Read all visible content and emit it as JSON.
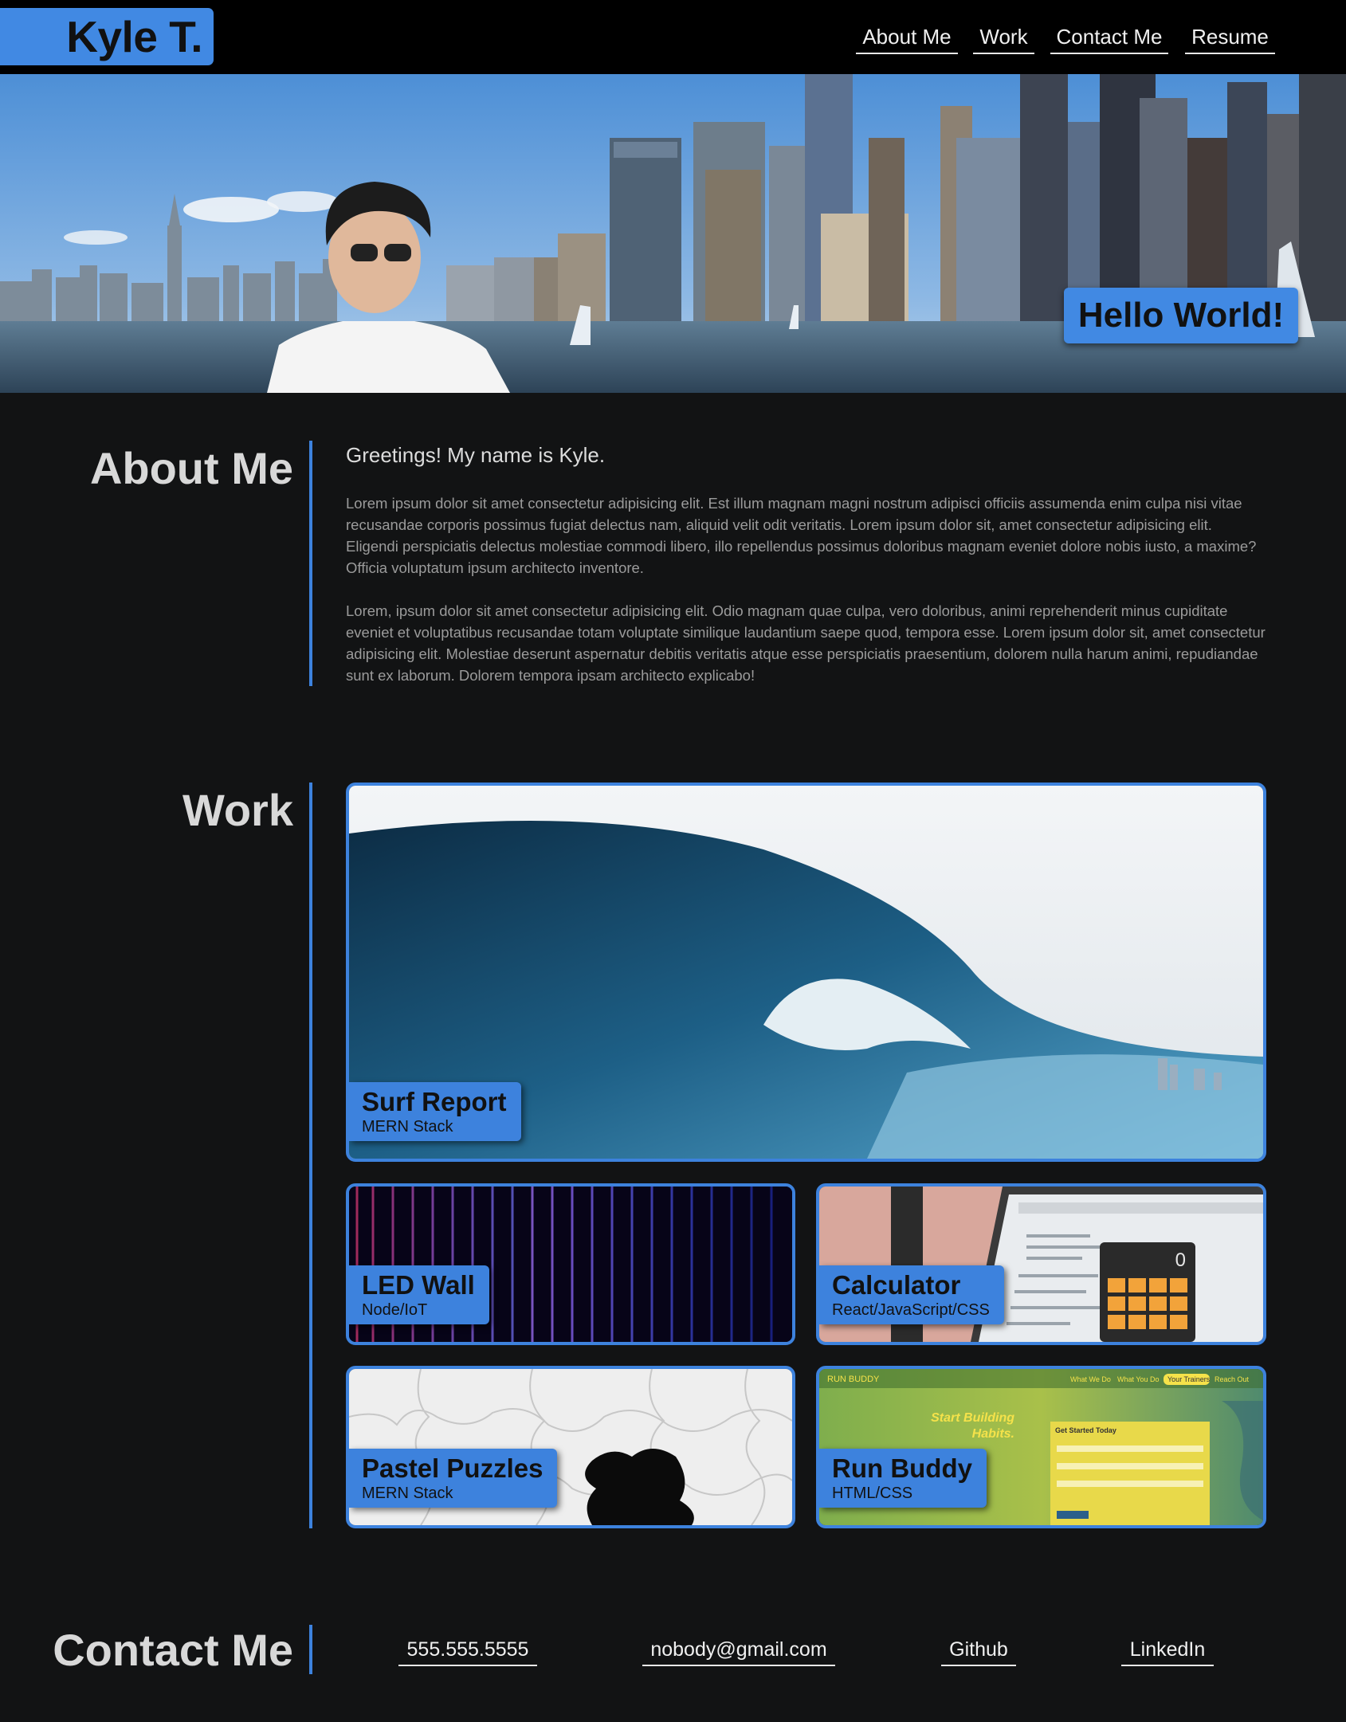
{
  "header": {
    "logo": "Kyle T.",
    "nav": [
      {
        "label": "About Me"
      },
      {
        "label": "Work"
      },
      {
        "label": "Contact Me"
      },
      {
        "label": "Resume"
      }
    ]
  },
  "hero": {
    "banner_text": "Hello World!"
  },
  "about": {
    "title": "About Me",
    "greeting": "Greetings! My name is Kyle.",
    "paragraphs": [
      "Lorem ipsum dolor sit amet consectetur adipisicing elit. Est illum magnam magni nostrum adipisci officiis assumenda enim culpa nisi vitae recusandae corporis possimus fugiat delectus nam, aliquid velit odit veritatis. Lorem ipsum dolor sit, amet consectetur adipisicing elit. Eligendi perspiciatis delectus molestiae commodi libero, illo repellendus possimus doloribus magnam eveniet dolore nobis iusto, a maxime? Officia voluptatum ipsum architecto inventore.",
      "Lorem, ipsum dolor sit amet consectetur adipisicing elit. Odio magnam quae culpa, vero doloribus, animi reprehenderit minus cupiditate eveniet et voluptatibus recusandae totam voluptate similique laudantium saepe quod, tempora esse. Lorem ipsum dolor sit, amet consectetur adipisicing elit. Molestiae deserunt aspernatur debitis veritatis atque esse perspiciatis praesentium, dolorem nulla harum animi, repudiandae sunt ex laborum. Dolorem tempora ipsam architecto explicabo!"
    ]
  },
  "work": {
    "title": "Work",
    "projects": [
      {
        "title": "Surf Report",
        "stack": "MERN Stack"
      },
      {
        "title": "LED Wall",
        "stack": "Node/IoT"
      },
      {
        "title": "Calculator",
        "stack": "React/JavaScript/CSS"
      },
      {
        "title": "Pastel Puzzles",
        "stack": "MERN Stack"
      },
      {
        "title": "Run Buddy",
        "stack": "HTML/CSS"
      }
    ],
    "run_buddy_preview": {
      "brand": "RUN BUDDY",
      "nav": [
        "What We Do",
        "What You Do",
        "Your Trainers",
        "Reach Out"
      ],
      "headline_1": "Start Building",
      "headline_2": "Habits.",
      "form_title": "Get Started Today"
    },
    "calculator_preview": {
      "display": "0"
    }
  },
  "contact": {
    "title": "Contact Me",
    "links": [
      {
        "label": "555.555.5555"
      },
      {
        "label": "nobody@gmail.com"
      },
      {
        "label": "Github"
      },
      {
        "label": "LinkedIn"
      }
    ]
  },
  "colors": {
    "accent": "#3d82dd",
    "background": "#121314",
    "header": "#000000"
  }
}
